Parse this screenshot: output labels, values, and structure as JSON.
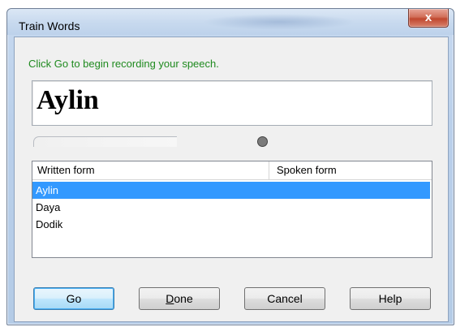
{
  "window": {
    "title": "Train Words",
    "close_glyph": "x"
  },
  "instruction": "Click Go to begin recording your speech.",
  "current_word": "Aylin",
  "level": {
    "fraction": 0,
    "fill_color": "#7fbf5f"
  },
  "status_indicator": {
    "color": "#7b7b7b"
  },
  "list": {
    "columns": [
      "Written form",
      "Spoken form"
    ],
    "rows": [
      {
        "written": "Aylin",
        "spoken": "",
        "selected": true
      },
      {
        "written": "Daya",
        "spoken": "",
        "selected": false
      },
      {
        "written": "Dodik",
        "spoken": "",
        "selected": false
      }
    ],
    "selection_color": "#3399ff"
  },
  "buttons": {
    "go": "Go",
    "done_mnemonic": "D",
    "done_rest": "one",
    "cancel": "Cancel",
    "help": "Help"
  },
  "colors": {
    "instruction_text": "#1f8a1f",
    "close_button": "#c0472e"
  }
}
